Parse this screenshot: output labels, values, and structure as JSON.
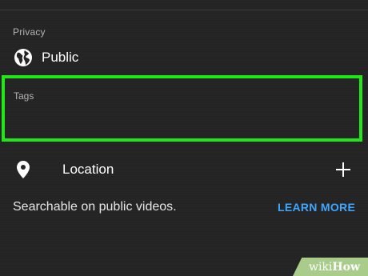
{
  "privacy": {
    "label": "Privacy",
    "value": "Public",
    "icon": "globe-icon"
  },
  "tags": {
    "label": "Tags",
    "highlight_color": "#22e61a"
  },
  "location": {
    "icon": "location-pin-icon",
    "label": "Location",
    "add_icon": "plus-icon"
  },
  "helper": {
    "text": "Searchable on public videos.",
    "link": "LEARN MORE",
    "link_color": "#3ea6ff"
  },
  "watermark": {
    "wiki": "wiki",
    "how": "How"
  }
}
